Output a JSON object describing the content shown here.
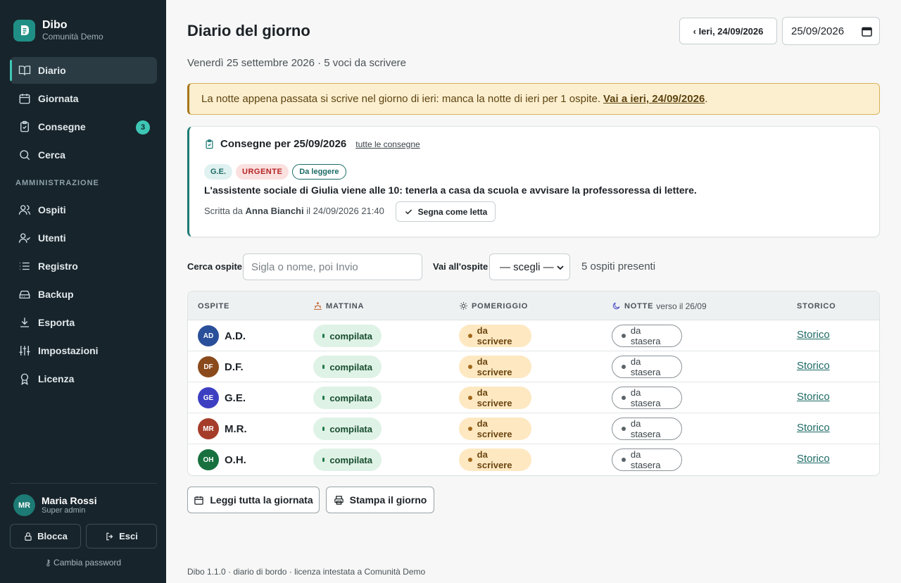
{
  "brand": {
    "name": "Dibo",
    "community": "Comunità Demo",
    "accent": "#1f8f86"
  },
  "nav": {
    "items": [
      {
        "label": "Diario",
        "icon": "book-icon",
        "active": true
      },
      {
        "label": "Giornata",
        "icon": "calendar-icon"
      },
      {
        "label": "Consegne",
        "icon": "clipboard-icon",
        "badge": "3"
      },
      {
        "label": "Cerca",
        "icon": "search-icon"
      }
    ],
    "section_title": "AMMINISTRAZIONE",
    "admin_items": [
      {
        "label": "Ospiti",
        "icon": "users-icon"
      },
      {
        "label": "Utenti",
        "icon": "user-check-icon"
      },
      {
        "label": "Registro",
        "icon": "list-icon"
      },
      {
        "label": "Backup",
        "icon": "drive-icon"
      },
      {
        "label": "Esporta",
        "icon": "download-icon"
      },
      {
        "label": "Impostazioni",
        "icon": "sliders-icon"
      },
      {
        "label": "Licenza",
        "icon": "award-icon"
      }
    ]
  },
  "user": {
    "initials": "MR",
    "name": "Maria Rossi",
    "role": "Super admin",
    "lock_label": "Blocca",
    "logout_label": "Esci",
    "change_password_label": "Cambia password"
  },
  "header": {
    "title": "Diario del giorno",
    "subtitle": "Venerdì 25 settembre 2026 · 5 voci da scrivere",
    "prev_day_label": "‹ Ieri, 24/09/2026",
    "date_value": "25/09/2026"
  },
  "alert": {
    "text": "La notte appena passata si scrive nel giorno di ieri: manca la notte di ieri per 1 ospite.",
    "link_label": "Vai a ieri, 24/09/2026",
    "suffix": "."
  },
  "consegne": {
    "title": "Consegne per 25/09/2026",
    "all_link": "tutte le consegne",
    "tags": {
      "guest": "G.E.",
      "urgent": "URGENTE",
      "status": "Da leggere"
    },
    "body": "L'assistente sociale di Giulia viene alle 10: tenerla a casa da scuola e avvisare la professoressa di lettere.",
    "meta_prefix": "Scritta da",
    "author": "Anna Bianchi",
    "meta_suffix": "il 24/09/2026 21:40",
    "mark_read_label": "Segna come letta"
  },
  "filters": {
    "search_label": "Cerca ospite",
    "search_placeholder": "Sigla o nome, poi Invio",
    "goto_label": "Vai all'ospite",
    "goto_value": "— scegli —",
    "present_count": "5 ospiti presenti"
  },
  "table": {
    "columns": {
      "guest": "OSPITE",
      "morning": "MATTINA",
      "afternoon": "POMERIGGIO",
      "night": "NOTTE",
      "night_extra": "verso il 26/09",
      "history": "STORICO"
    },
    "rows": [
      {
        "initials": "AD",
        "code": "A.D.",
        "color": "#2a4f9a",
        "morning": "compilata",
        "afternoon": "da scrivere",
        "night": "da stasera",
        "history": "Storico"
      },
      {
        "initials": "DF",
        "code": "D.F.",
        "color": "#8a4a1c",
        "morning": "compilata",
        "afternoon": "da scrivere",
        "night": "da stasera",
        "history": "Storico"
      },
      {
        "initials": "GE",
        "code": "G.E.",
        "color": "#3d3fc2",
        "morning": "compilata",
        "afternoon": "da scrivere",
        "night": "da stasera",
        "history": "Storico"
      },
      {
        "initials": "MR",
        "code": "M.R.",
        "color": "#a53c2a",
        "morning": "compilata",
        "afternoon": "da scrivere",
        "night": "da stasera",
        "history": "Storico"
      },
      {
        "initials": "OH",
        "code": "O.H.",
        "color": "#18703f",
        "morning": "compilata",
        "afternoon": "da scrivere",
        "night": "da stasera",
        "history": "Storico"
      }
    ]
  },
  "actions": {
    "read_day": "Leggi tutta la giornata",
    "print_day": "Stampa il giorno"
  },
  "footer": "Dibo 1.1.0 · diario di bordo · licenza intestata a Comunità Demo"
}
